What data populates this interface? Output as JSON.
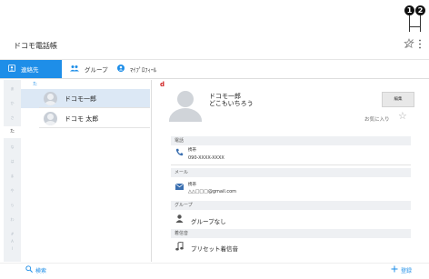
{
  "callouts": [
    "1",
    "2"
  ],
  "app": {
    "title": "ドコモ電話帳"
  },
  "tabs": [
    {
      "label": "連絡先",
      "icon": "contacts-icon"
    },
    {
      "label": "グループ",
      "icon": "group-icon"
    },
    {
      "label": "ﾏｲﾌﾟﾛﾌｨｰﾙ",
      "icon": "profile-icon"
    }
  ],
  "index": {
    "items": [
      "あ",
      "か",
      "さ",
      "た",
      "な",
      "は",
      "ま",
      "や",
      "ら",
      "わ",
      "#",
      "A",
      "I"
    ],
    "selected": "た"
  },
  "list": {
    "section": "た",
    "contacts": [
      "ドコモ一郎",
      "ドコモ 太郎"
    ]
  },
  "detail": {
    "badge": "d",
    "name": "ドコモ一郎",
    "reading": "どこもいちろう",
    "edit_label": "編集",
    "favorite_label": "お気に入り",
    "sections": {
      "phone": "電話",
      "mail": "メール",
      "group": "グループ",
      "ringtone": "着信音"
    },
    "phone_type": "携帯",
    "phone_number": "090-XXXX-XXXX",
    "mail_type": "携帯",
    "mail_address": "△△□□□@gmail.com",
    "group_value": "グループなし",
    "ringtone_value": "プリセット着信音"
  },
  "bottom": {
    "search_label": "検索",
    "register_label": "登録"
  },
  "colors": {
    "accent": "#1e8ee8",
    "selected_row": "#dce8f5",
    "badge": "#d02020"
  }
}
